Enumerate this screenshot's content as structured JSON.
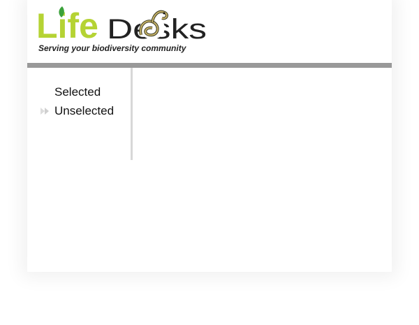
{
  "brand": {
    "name_part1": "Life",
    "name_part2": "Desks",
    "tagline": "Serving your biodiversity community",
    "colors": {
      "green": "#b5d334",
      "dark": "#222222",
      "leaf": "#3aa13a",
      "bar": "#999999"
    }
  },
  "nav": {
    "items": [
      {
        "label": "Selected",
        "state": "selected",
        "icon": "none"
      },
      {
        "label": "Unselected",
        "state": "unselected",
        "icon": "double-chevron-right-icon"
      }
    ]
  }
}
